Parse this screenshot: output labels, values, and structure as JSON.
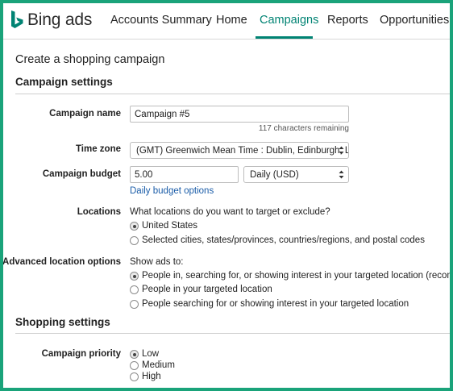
{
  "header": {
    "logo_text": "Bing ads",
    "nav": [
      {
        "label": "Accounts Summary",
        "active": false
      },
      {
        "label": "Home",
        "active": false
      },
      {
        "label": "Campaigns",
        "active": true
      },
      {
        "label": "Reports",
        "active": false
      },
      {
        "label": "Opportunities",
        "active": false
      }
    ],
    "accent_color": "#008373"
  },
  "page_title": "Create a shopping campaign",
  "campaign_settings": {
    "title": "Campaign settings",
    "campaign_name": {
      "label": "Campaign name",
      "value": "Campaign #5",
      "hint": "117 characters remaining"
    },
    "time_zone": {
      "label": "Time zone",
      "selected": "(GMT) Greenwich Mean Time : Dublin, Edinburgh, Lisb"
    },
    "budget": {
      "label": "Campaign budget",
      "value": "5.00",
      "type_selected": "Daily (USD)",
      "options_link": "Daily budget options"
    },
    "locations": {
      "label": "Locations",
      "question": "What locations do you want to target or exclude?",
      "options": [
        {
          "label": "United States",
          "checked": true
        },
        {
          "label": "Selected cities, states/provinces, countries/regions, and postal codes",
          "checked": false
        }
      ]
    },
    "advanced_locations": {
      "label": "Advanced location options",
      "prompt": "Show ads to:",
      "options": [
        {
          "label": "People in, searching for, or showing interest in your targeted location (recommended)",
          "checked": true
        },
        {
          "label": "People in your targeted location",
          "checked": false
        },
        {
          "label": "People searching for or showing interest in your targeted location",
          "checked": false
        }
      ]
    }
  },
  "shopping_settings": {
    "title": "Shopping settings",
    "priority": {
      "label": "Campaign priority",
      "options": [
        {
          "label": "Low",
          "checked": true
        },
        {
          "label": "Medium",
          "checked": false
        },
        {
          "label": "High",
          "checked": false
        }
      ]
    }
  }
}
